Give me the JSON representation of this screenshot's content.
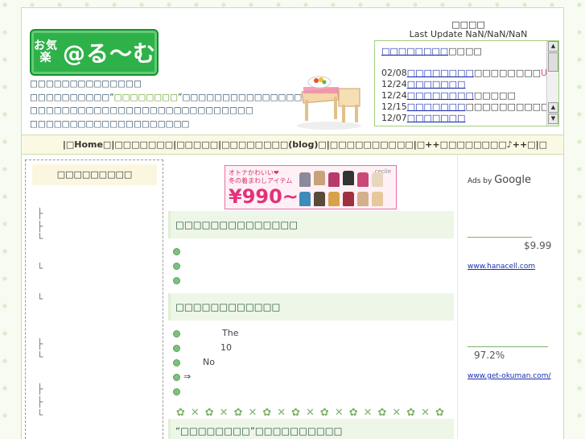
{
  "header": {
    "logo_text_small": "お気楽",
    "logo_text_main": "@る〜む",
    "intro_lines": [
      "□□□□□□□□□□□□□□",
      "□□□□□□□□□□“",
      "□□□□□□□□□□□□□□□□□□□□□□□□□□□□",
      "□□□□□□□□□□□□□□□□□□□□"
    ],
    "intro_highlight": "□□□□□□□□",
    "intro_line2_tail": "”□□□□□□□□□□□□□□□□"
  },
  "update": {
    "title": "□□□□",
    "last_update": "Last Update NaN/NaN/NaN"
  },
  "news": {
    "head_link": "□□□□□□□□",
    "head_tail": "□□□□",
    "items": [
      {
        "date": "02/08",
        "link": "□□□□□□□□",
        "text": "□□□□□□□□",
        "badge": "Up!"
      },
      {
        "date": "12/24",
        "link": "□□□□□□□",
        "text": "",
        "badge": ""
      },
      {
        "date": "12/24",
        "link": "□□□□□□□□",
        "text": "□□□□□",
        "badge": ""
      },
      {
        "date": "12/15",
        "link": "□□□□□□□",
        "text": "□□□□□□□□□□□□",
        "badge": ""
      },
      {
        "date": "12/07",
        "link": "□□□□□□□",
        "text": "",
        "badge": ""
      }
    ]
  },
  "nav": {
    "items": [
      "|□Home□|",
      "□□□□□□□|",
      "□□□□□|",
      "□□□□□□□□(blog)□|",
      "□□□□□□□□□□|",
      "□++□□□□□□□□♪++□|",
      "□"
    ]
  },
  "left": {
    "title": "□□□□□□□□□"
  },
  "banner": {
    "line1": "オトナかわいい❤",
    "line2": "冬の着まわしアイテム",
    "price": "¥990~",
    "brand": "cecile"
  },
  "center": {
    "section1_title": "□□□□□□□□□□□□□□",
    "section2_title": "□□□□□□□□□□□□",
    "section2_rows": [
      "The",
      "10",
      "No",
      "⇒",
      ""
    ],
    "section3_title": "“□□□□□□□□”□□□□□□□□□□"
  },
  "right": {
    "ads_by": "Ads by",
    "google": "Google",
    "price1": "$9.99",
    "link1": "www.hanacell.com",
    "pct": "97.2%",
    "link2": "www.get-okuman.com/"
  },
  "colors": {
    "accent_green": "#2fb14a",
    "link_blue": "#1a2fae",
    "pink": "#e0448c"
  }
}
